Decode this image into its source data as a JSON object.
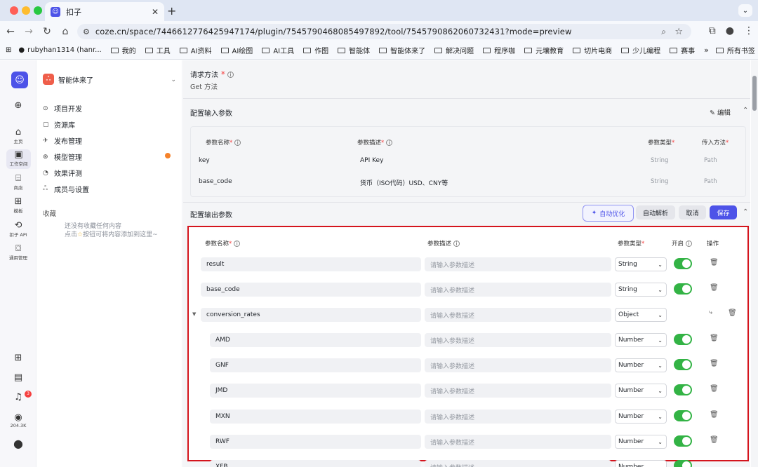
{
  "browser": {
    "tab_title": "扣子",
    "url": "coze.cn/space/7446612776425947174/plugin/7545790468085497892/tool/7545790862060732431?mode=preview",
    "bookmarks": [
      "rubyhan1314 (hanr...",
      "我的",
      "工具",
      "AI资料",
      "AI绘图",
      "AI工具",
      "作图",
      "智能体",
      "智能体来了",
      "解决问题",
      "程序咖",
      "元壤教育",
      "切片电商",
      "少儿编程",
      "赛事"
    ],
    "more_bookmarks": "»",
    "all_bookmarks": "所有书签"
  },
  "rail": {
    "home": "主页",
    "workspace": "工作空间",
    "store": "商店",
    "templates": "模板",
    "api": "扣子 API",
    "general": "通用管理",
    "notif_count": "3",
    "coins": "204.3K"
  },
  "sidebar": {
    "workspace_name": "智能体来了",
    "items": [
      {
        "label": "项目开发",
        "icon": "project-icon"
      },
      {
        "label": "资源库",
        "icon": "library-icon"
      },
      {
        "label": "发布管理",
        "icon": "publish-icon"
      },
      {
        "label": "模型管理",
        "icon": "model-icon"
      },
      {
        "label": "效果评测",
        "icon": "eval-icon"
      },
      {
        "label": "成员与设置",
        "icon": "members-icon"
      }
    ],
    "favorites_title": "收藏",
    "favorites_empty_1": "还没有收藏任何内容",
    "favorites_empty_2": "点击",
    "favorites_empty_3": "按钮可将内容添加到这里~"
  },
  "request": {
    "label": "请求方法",
    "value": "Get 方法"
  },
  "input_section": {
    "title": "配置输入参数",
    "edit_label": "编辑",
    "headers": {
      "name": "参数名称",
      "desc": "参数描述",
      "type": "参数类型",
      "method": "传入方法"
    },
    "rows": [
      {
        "name": "key",
        "desc": "API Key",
        "type": "String",
        "method": "Path"
      },
      {
        "name": "base_code",
        "desc": "货币（ISO代码）USD、CNY等",
        "type": "String",
        "method": "Path"
      }
    ]
  },
  "output_section": {
    "title": "配置输出参数",
    "auto_optimize": "自动优化",
    "auto_parse": "自动解析",
    "cancel": "取消",
    "save": "保存",
    "headers": {
      "name": "参数名称",
      "desc": "参数描述",
      "type": "参数类型",
      "enabled": "开启",
      "ops": "操作"
    },
    "desc_placeholder": "请输入参数描述",
    "rows": [
      {
        "name": "result",
        "type": "String",
        "level": 0
      },
      {
        "name": "base_code",
        "type": "String",
        "level": 0
      },
      {
        "name": "conversion_rates",
        "type": "Object",
        "level": 0
      },
      {
        "name": "AMD",
        "type": "Number",
        "level": 1
      },
      {
        "name": "GNF",
        "type": "Number",
        "level": 1
      },
      {
        "name": "JMD",
        "type": "Number",
        "level": 1
      },
      {
        "name": "MXN",
        "type": "Number",
        "level": 1
      },
      {
        "name": "RWF",
        "type": "Number",
        "level": 1
      },
      {
        "name": "XFB",
        "type": "Number",
        "level": 1
      }
    ]
  }
}
